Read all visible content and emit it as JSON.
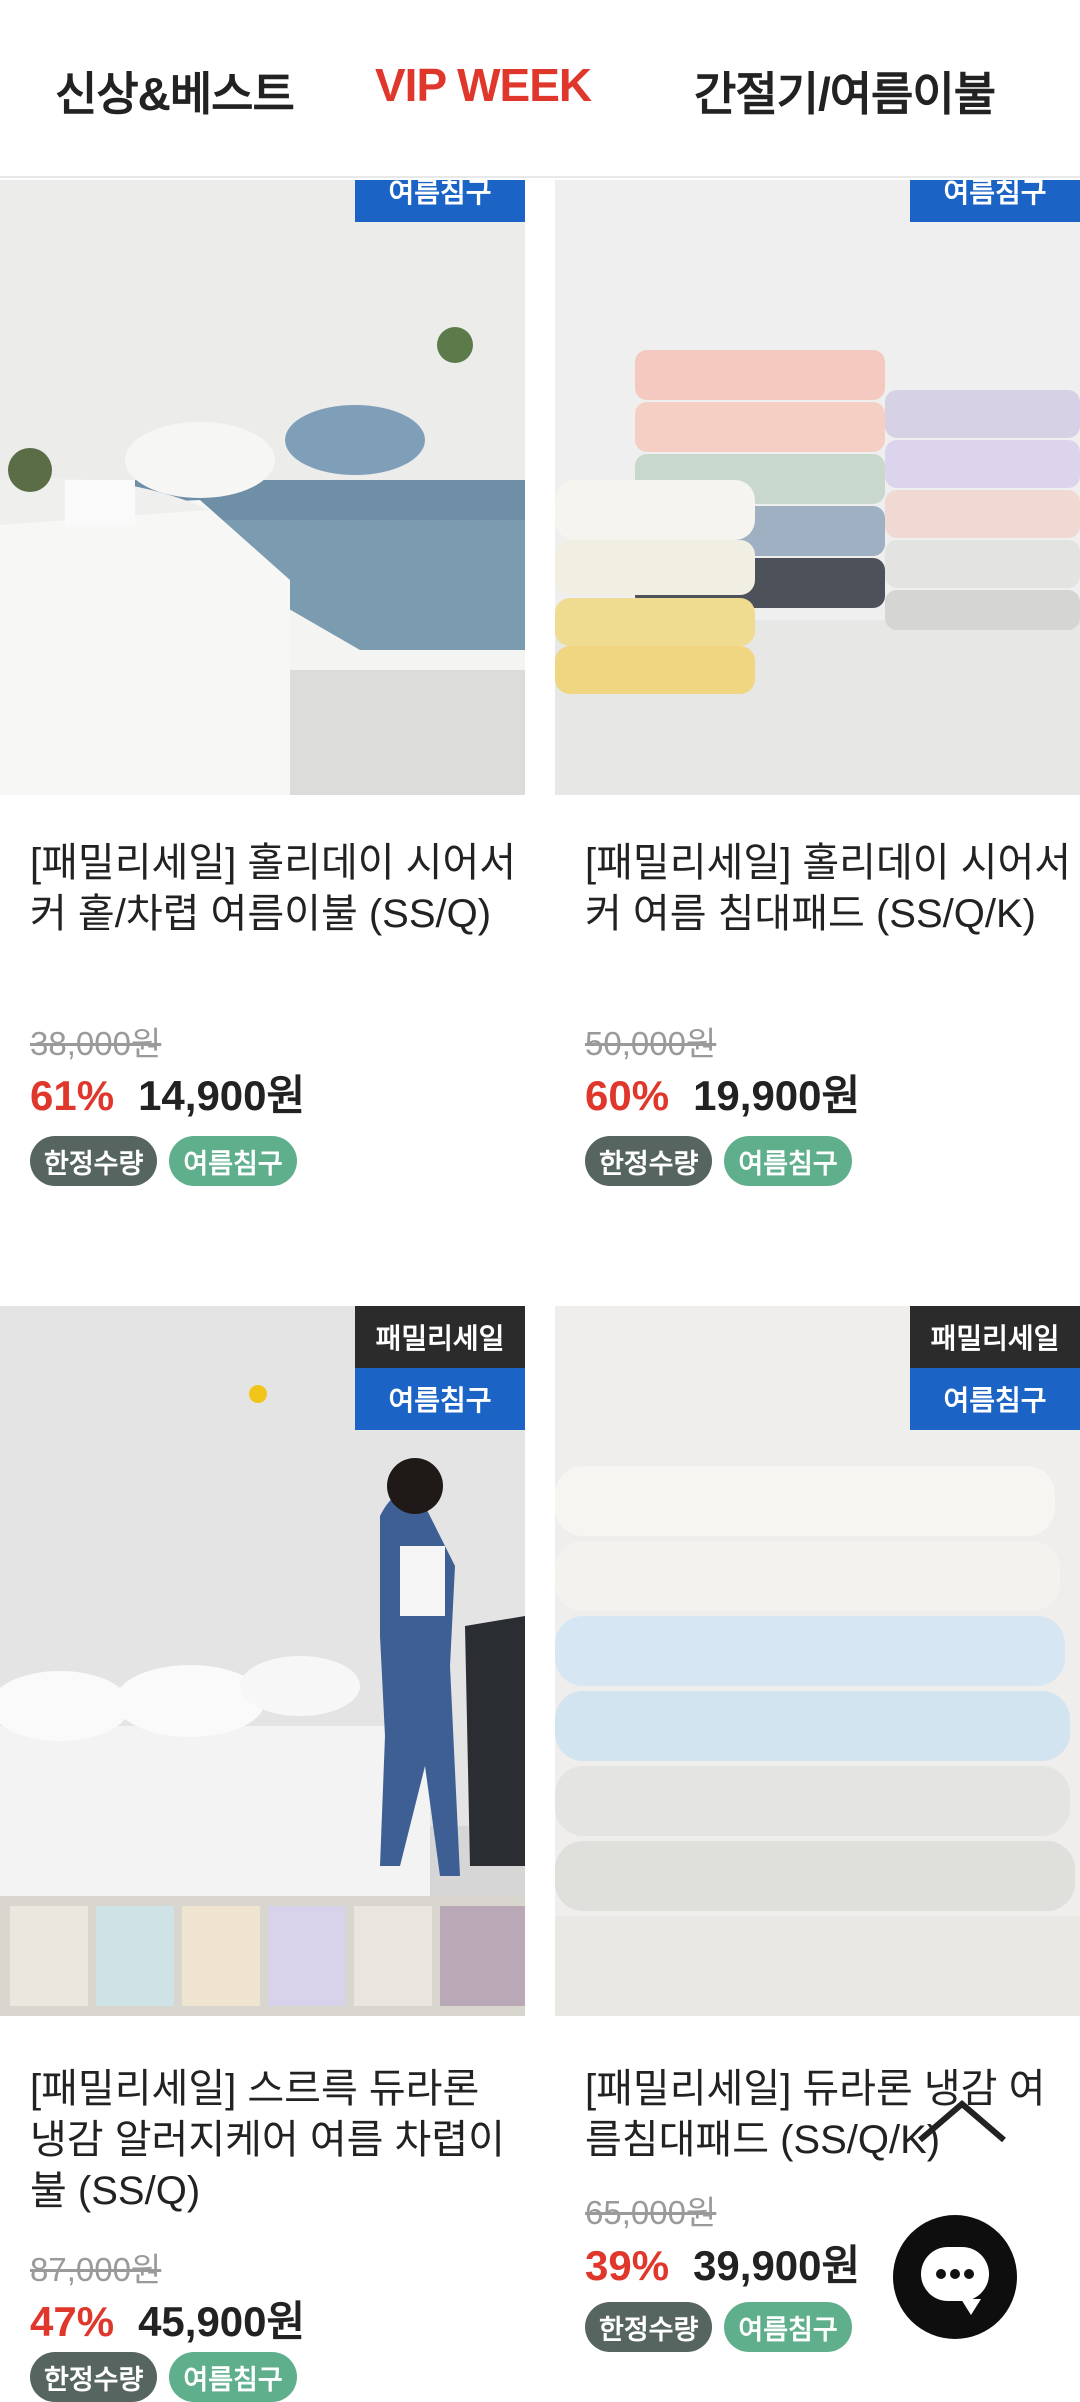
{
  "nav": {
    "tabs": [
      {
        "label": "신상&베스트"
      },
      {
        "label": "VIP WEEK"
      },
      {
        "label": "간절기/여름이불"
      }
    ]
  },
  "products": [
    {
      "badges": [
        "여름침구"
      ],
      "title": "[패밀리세일] 홀리데이 시어서커 홑/차렵 여름이불 (SS/Q)",
      "original_price": "38,000원",
      "discount": "61%",
      "price": "14,900원",
      "tags": [
        "한정수량",
        "여름침구"
      ]
    },
    {
      "badges": [
        "여름침구"
      ],
      "title": "[패밀리세일] 홀리데이 시어서커 여름 침대패드 (SS/Q/K)",
      "original_price": "50,000원",
      "discount": "60%",
      "price": "19,900원",
      "tags": [
        "한정수량",
        "여름침구"
      ]
    },
    {
      "badges": [
        "패밀리세일",
        "여름침구"
      ],
      "title": "[패밀리세일] 스르륵 듀라론 냉감 알러지케어 여름 차렵이불 (SS/Q)",
      "original_price": "87,000원",
      "discount": "47%",
      "price": "45,900원",
      "tags": [
        "한정수량",
        "여름침구"
      ]
    },
    {
      "badges": [
        "패밀리세일",
        "여름침구"
      ],
      "title": "[패밀리세일] 듀라론 냉감 여름침대패드 (SS/Q/K)",
      "original_price": "65,000원",
      "discount": "39%",
      "price": "39,900원",
      "tags": [
        "한정수량",
        "여름침구"
      ]
    }
  ],
  "colors": {
    "accent_red": "#e0372c",
    "badge_blue": "#1c63c6",
    "tag_gray": "#56655f",
    "tag_green": "#5fae8c"
  },
  "icons": {
    "chat": "chat-bubble-icon",
    "scroll_top": "chevron-up-icon"
  }
}
